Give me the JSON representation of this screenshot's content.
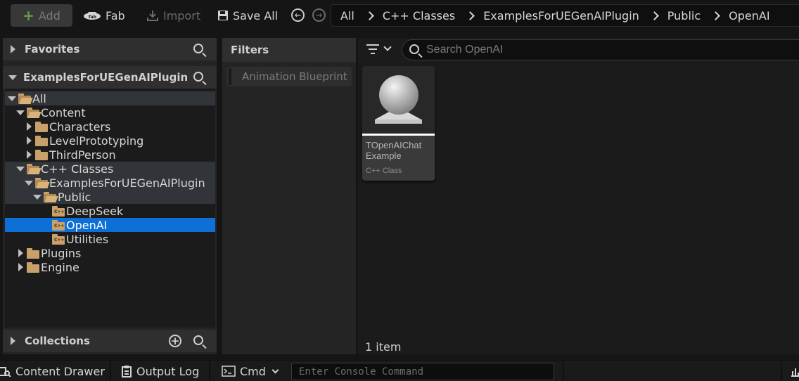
{
  "toolbar": {
    "add_label": "Add",
    "fab_label": "Fab",
    "import_label": "Import",
    "save_all_label": "Save All"
  },
  "breadcrumb": [
    "All",
    "C++ Classes",
    "ExamplesForUEGenAIPlugin",
    "Public",
    "OpenAI"
  ],
  "sources": {
    "favorites_label": "Favorites",
    "project_label": "ExamplesForUEGenAIPlugin",
    "collections_label": "Collections",
    "tree": [
      {
        "label": "All",
        "depth": 0,
        "state": "expanded",
        "icon": "folder-open",
        "highlight": true
      },
      {
        "label": "Content",
        "depth": 1,
        "state": "expanded",
        "icon": "folder-open"
      },
      {
        "label": "Characters",
        "depth": 2,
        "state": "collapsed",
        "icon": "folder"
      },
      {
        "label": "LevelPrototyping",
        "depth": 2,
        "state": "collapsed",
        "icon": "folder"
      },
      {
        "label": "ThirdPerson",
        "depth": 2,
        "state": "collapsed",
        "icon": "folder"
      },
      {
        "label": "C++ Classes",
        "depth": 1,
        "state": "expanded",
        "icon": "folder-open",
        "highlight": true
      },
      {
        "label": "ExamplesForUEGenAIPlugin",
        "depth": 2,
        "state": "expanded",
        "icon": "folder-open",
        "highlight": true
      },
      {
        "label": "Public",
        "depth": 3,
        "state": "expanded",
        "icon": "folder-open",
        "highlight": true
      },
      {
        "label": "DeepSeek",
        "depth": 4,
        "state": "leaf",
        "icon": "cpp-folder"
      },
      {
        "label": "OpenAI",
        "depth": 4,
        "state": "leaf",
        "icon": "cpp-folder",
        "selected": true
      },
      {
        "label": "Utilities",
        "depth": 4,
        "state": "leaf",
        "icon": "cpp-folder"
      },
      {
        "label": "Plugins",
        "depth": 1,
        "state": "collapsed",
        "icon": "folder"
      },
      {
        "label": "Engine",
        "depth": 1,
        "state": "collapsed",
        "icon": "folder"
      }
    ]
  },
  "filters": {
    "title": "Filters",
    "chips": [
      "Animation Blueprint"
    ]
  },
  "content": {
    "search_placeholder": "Search OpenAI",
    "assets": [
      {
        "name": "TOpenAIChat Example",
        "type": "C++ Class"
      }
    ],
    "item_count": "1 item"
  },
  "statusbar": {
    "content_drawer": "Content Drawer",
    "output_log": "Output Log",
    "cmd": "Cmd",
    "console_placeholder": "Enter Console Command"
  }
}
